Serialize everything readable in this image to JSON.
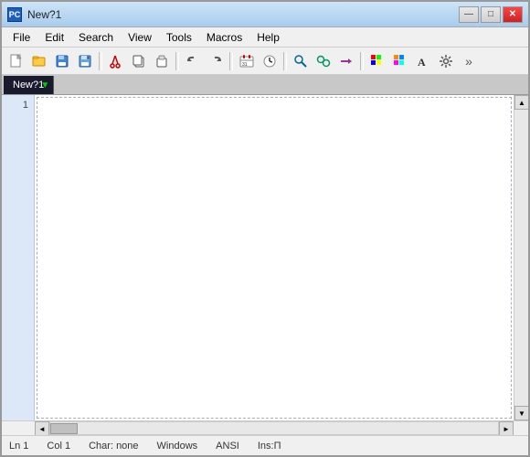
{
  "window": {
    "title": "New?1",
    "icon_label": "PC"
  },
  "title_buttons": {
    "minimize": "—",
    "maximize": "□",
    "close": "✕"
  },
  "menu": {
    "items": [
      "File",
      "Edit",
      "Search",
      "View",
      "Tools",
      "Macros",
      "Help"
    ]
  },
  "toolbar": {
    "buttons": [
      {
        "name": "new-button",
        "icon": "📄",
        "label": "New"
      },
      {
        "name": "open-button",
        "icon": "📂",
        "label": "Open"
      },
      {
        "name": "save-button",
        "icon": "💾",
        "label": "Save"
      },
      {
        "name": "saveas-button",
        "icon": "📋",
        "label": "Save As"
      },
      {
        "name": "cut-button",
        "icon": "✂",
        "label": "Cut"
      },
      {
        "name": "copy-button",
        "icon": "⎘",
        "label": "Copy"
      },
      {
        "name": "paste-button",
        "icon": "📌",
        "label": "Paste"
      },
      {
        "name": "undo-button",
        "icon": "↺",
        "label": "Undo"
      },
      {
        "name": "redo-button",
        "icon": "↻",
        "label": "Redo"
      },
      {
        "name": "date-button",
        "icon": "📅",
        "label": "Date"
      },
      {
        "name": "time-button",
        "icon": "🕐",
        "label": "Time"
      },
      {
        "name": "search-button",
        "icon": "🔍",
        "label": "Search"
      },
      {
        "name": "replace-button",
        "icon": "⇄",
        "label": "Replace"
      },
      {
        "name": "goto-button",
        "icon": "→",
        "label": "Go To"
      },
      {
        "name": "color1-button",
        "icon": "🎨",
        "label": "Color1"
      },
      {
        "name": "color2-button",
        "icon": "🖌",
        "label": "Color2"
      },
      {
        "name": "font-button",
        "icon": "A",
        "label": "Font"
      },
      {
        "name": "settings-button",
        "icon": "⚙",
        "label": "Settings"
      },
      {
        "name": "more-button",
        "icon": "»",
        "label": "More"
      }
    ]
  },
  "tab": {
    "name": "New?1",
    "active": true
  },
  "editor": {
    "lines": [
      ""
    ],
    "line_count": 1
  },
  "status_bar": {
    "line": "Ln 1",
    "col": "Col 1",
    "char": "Char: none",
    "line_ending": "Windows",
    "encoding": "ANSI",
    "extra": "Ins:П"
  }
}
